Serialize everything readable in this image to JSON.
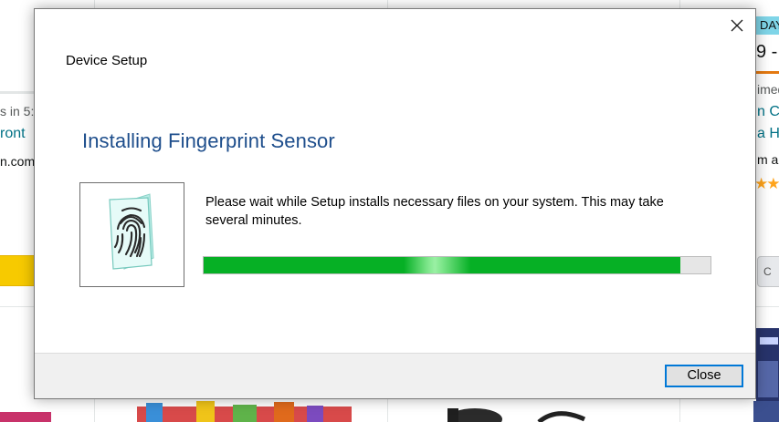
{
  "background_page": {
    "left_fragments": [
      "s in 5:",
      "ront",
      "n.com"
    ],
    "right_fragments": [
      "DAY",
      "9 -",
      "imed",
      "n Cl",
      "a He",
      "m a",
      "C"
    ],
    "rating_stars": "★★"
  },
  "dialog": {
    "title": "Device Setup",
    "heading": "Installing Fingerprint Sensor",
    "message": "Please wait while Setup installs necessary files on your system. This may take several minutes.",
    "progress_percent": 94,
    "close_button_label": "Close",
    "close_icon": "close-icon",
    "device_icon": "fingerprint-icon"
  },
  "colors": {
    "heading": "#1e4e8c",
    "progress_fill": "#06b025",
    "button_focus_border": "#0078d7",
    "footer_bg": "#f0f0f0"
  }
}
